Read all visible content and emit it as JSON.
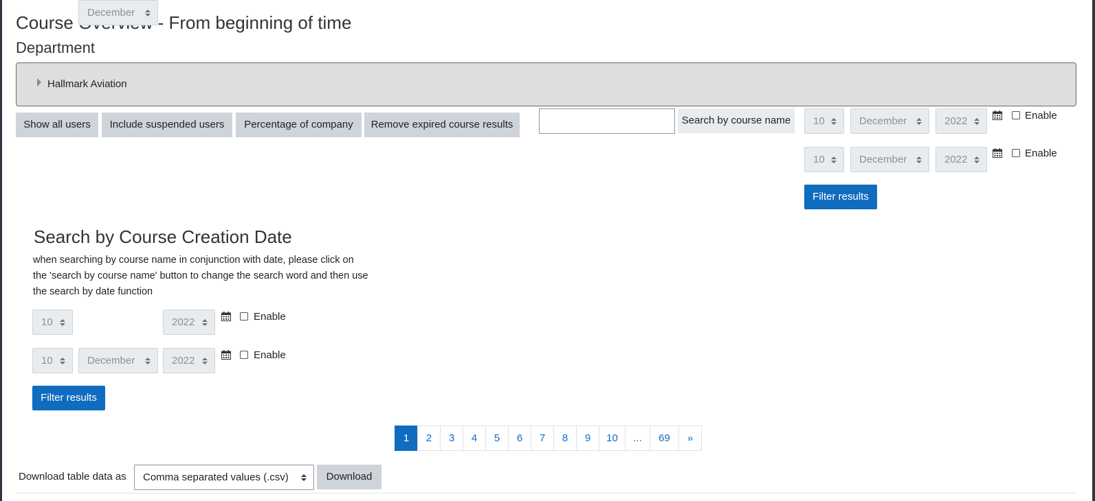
{
  "page": {
    "title": "Course Overview - From beginning of time",
    "department_heading": "Department",
    "department_name": "Hallmark Aviation"
  },
  "toolbar": {
    "show_all_users": "Show all users",
    "include_suspended": "Include suspended users",
    "percentage_of_company": "Percentage of company",
    "remove_expired": "Remove expired course results"
  },
  "course_search": {
    "input_value": "",
    "button_label": "Search by course name"
  },
  "top_date_filter": {
    "from": {
      "day": "10",
      "month": "December",
      "year": "2022",
      "enable_label": "Enable",
      "enabled": false
    },
    "to": {
      "day": "10",
      "month": "December",
      "year": "2022",
      "enable_label": "Enable",
      "enabled": false
    },
    "filter_button": "Filter results"
  },
  "creation_date": {
    "heading": "Search by Course Creation Date",
    "help": "when searching by course name in conjunction with date, please click on the 'search by course name' button to change the search word and then use the search by date function",
    "from": {
      "day": "10",
      "month": "December",
      "year": "2022",
      "enable_label": "Enable",
      "enabled": false
    },
    "to": {
      "day": "10",
      "month": "December",
      "year": "2022",
      "enable_label": "Enable",
      "enabled": false
    },
    "filter_button": "Filter results"
  },
  "pagination": {
    "pages": [
      "1",
      "2",
      "3",
      "4",
      "5",
      "6",
      "7",
      "8",
      "9",
      "10",
      "...",
      "69",
      "»"
    ],
    "current": "1"
  },
  "download": {
    "label": "Download table data as",
    "format": "Comma separated values (.csv)",
    "button": "Download"
  },
  "icons": {
    "calendar": "calendar-icon",
    "caret": "caret-right-icon"
  },
  "colors": {
    "primary": "#0f6cbf",
    "secondary_button": "#ced4da",
    "department_box": "#dedede"
  }
}
